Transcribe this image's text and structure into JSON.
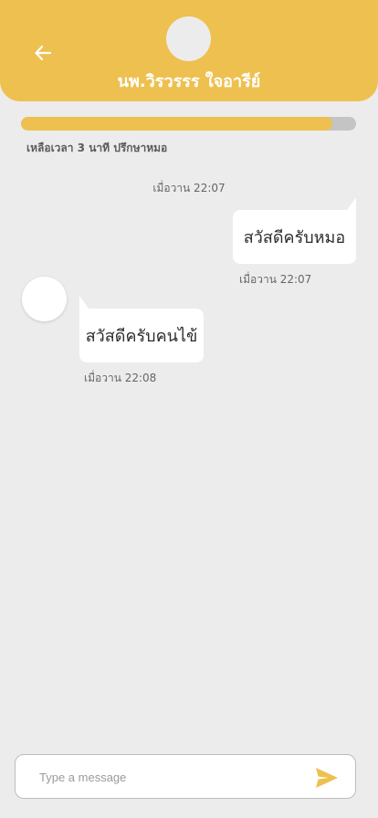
{
  "header": {
    "doctor_name": "นพ.วิรวรรร ใจอารีย์",
    "accent_color": "#eec04f"
  },
  "session": {
    "progress_fraction": 0.93,
    "time_left_text": "เหลือเวลา 3 นาที ปรึกษาหมอ"
  },
  "messages": [
    {
      "text": "สวัสดีครับหมอ",
      "time": "เมื่อวาน 22:07",
      "from": "me"
    },
    {
      "text": "สวัสดีครับคนไข้",
      "time": "เมื่อวาน 22:08",
      "from": "doctor"
    }
  ],
  "day_separator": "เมื่อวาน 22:07",
  "composer": {
    "placeholder": "Type a message",
    "value": ""
  },
  "icons": {
    "back": "arrow-left-icon",
    "send": "send-icon"
  }
}
